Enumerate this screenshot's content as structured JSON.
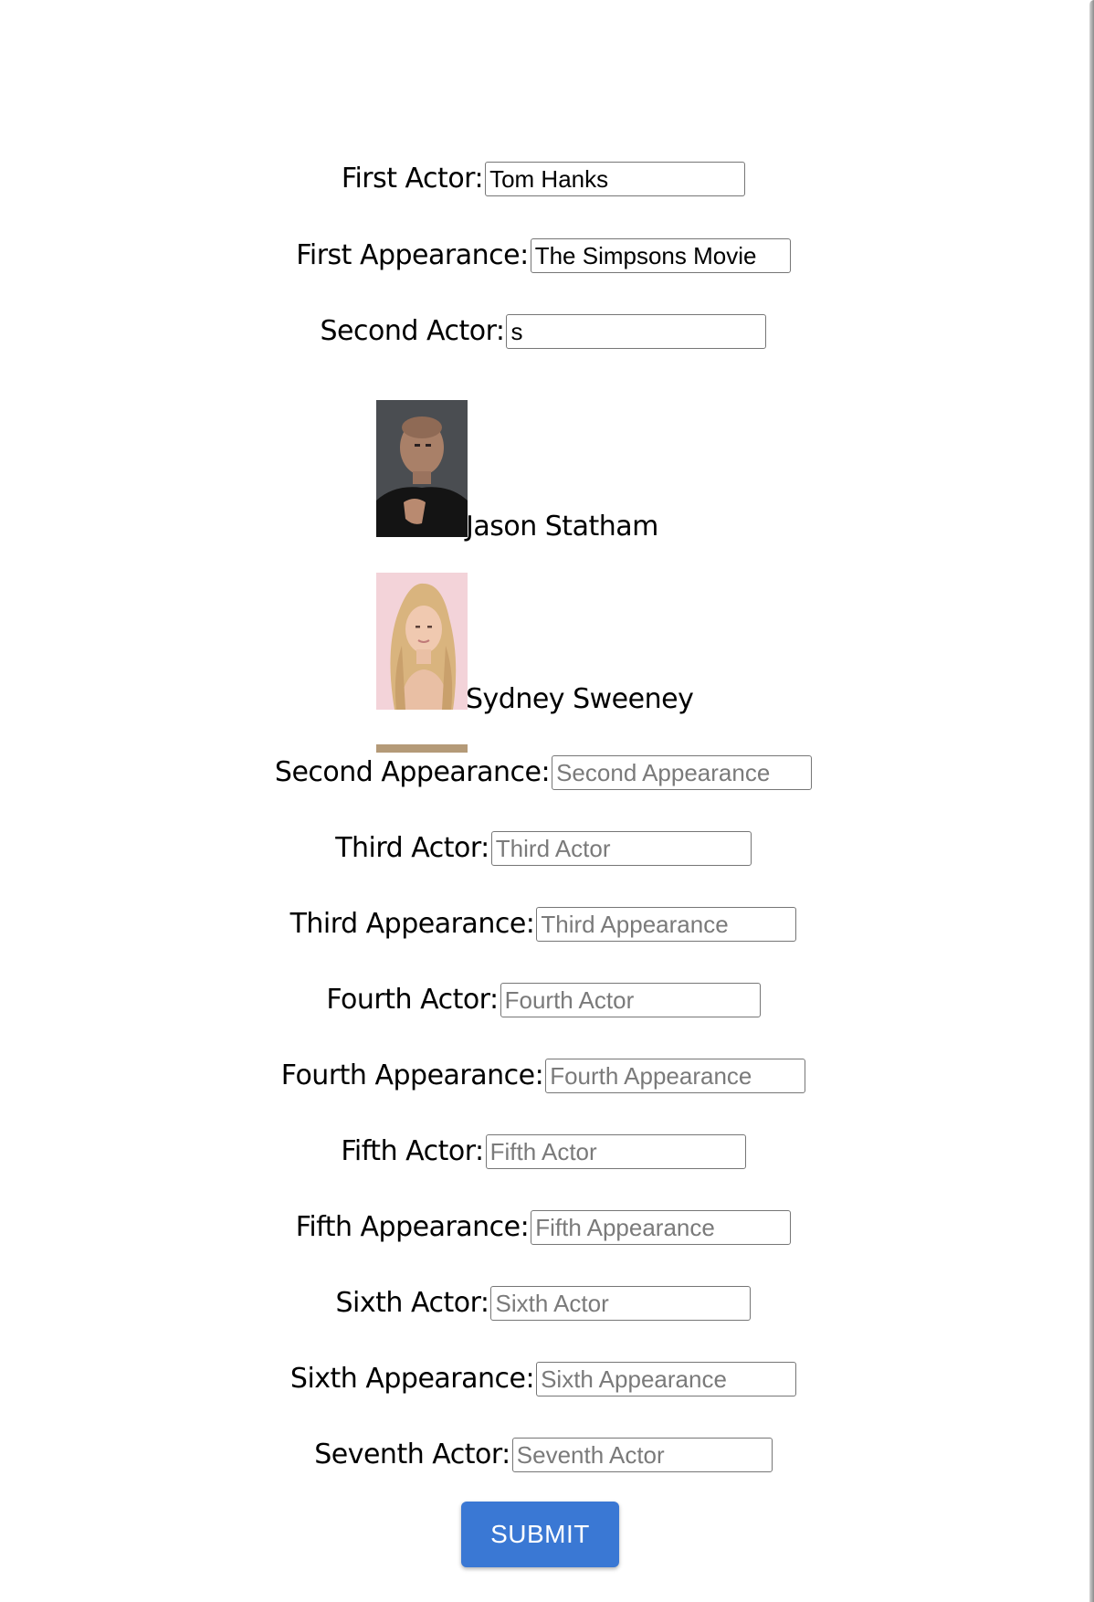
{
  "fields": [
    {
      "label": "First Actor:",
      "value": "Tom Hanks",
      "placeholder": "First Actor"
    },
    {
      "label": "First Appearance:",
      "value": "The Simpsons Movie",
      "placeholder": "First Appearance"
    },
    {
      "label": "Second Actor:",
      "value": "s",
      "placeholder": "Second Actor"
    },
    {
      "label": "Second Appearance:",
      "value": "",
      "placeholder": "Second Appearance"
    },
    {
      "label": "Third Actor:",
      "value": "",
      "placeholder": "Third Actor"
    },
    {
      "label": "Third Appearance:",
      "value": "",
      "placeholder": "Third Appearance"
    },
    {
      "label": "Fourth Actor:",
      "value": "",
      "placeholder": "Fourth Actor"
    },
    {
      "label": "Fourth Appearance:",
      "value": "",
      "placeholder": "Fourth Appearance"
    },
    {
      "label": "Fifth Actor:",
      "value": "",
      "placeholder": "Fifth Actor"
    },
    {
      "label": "Fifth Appearance:",
      "value": "",
      "placeholder": "Fifth Appearance"
    },
    {
      "label": "Sixth Actor:",
      "value": "",
      "placeholder": "Sixth Actor"
    },
    {
      "label": "Sixth Appearance:",
      "value": "",
      "placeholder": "Sixth Appearance"
    },
    {
      "label": "Seventh Actor:",
      "value": "",
      "placeholder": "Seventh Actor"
    }
  ],
  "suggestions": [
    {
      "name": "Jason Statham",
      "photo_icon": "actor-photo-icon"
    },
    {
      "name": "Sydney Sweeney",
      "photo_icon": "actor-photo-icon"
    }
  ],
  "submit_label": "SUBMIT",
  "colors": {
    "submit_bg": "#3a78d4",
    "submit_text": "#ffffff",
    "placeholder": "#7a7a7a"
  }
}
